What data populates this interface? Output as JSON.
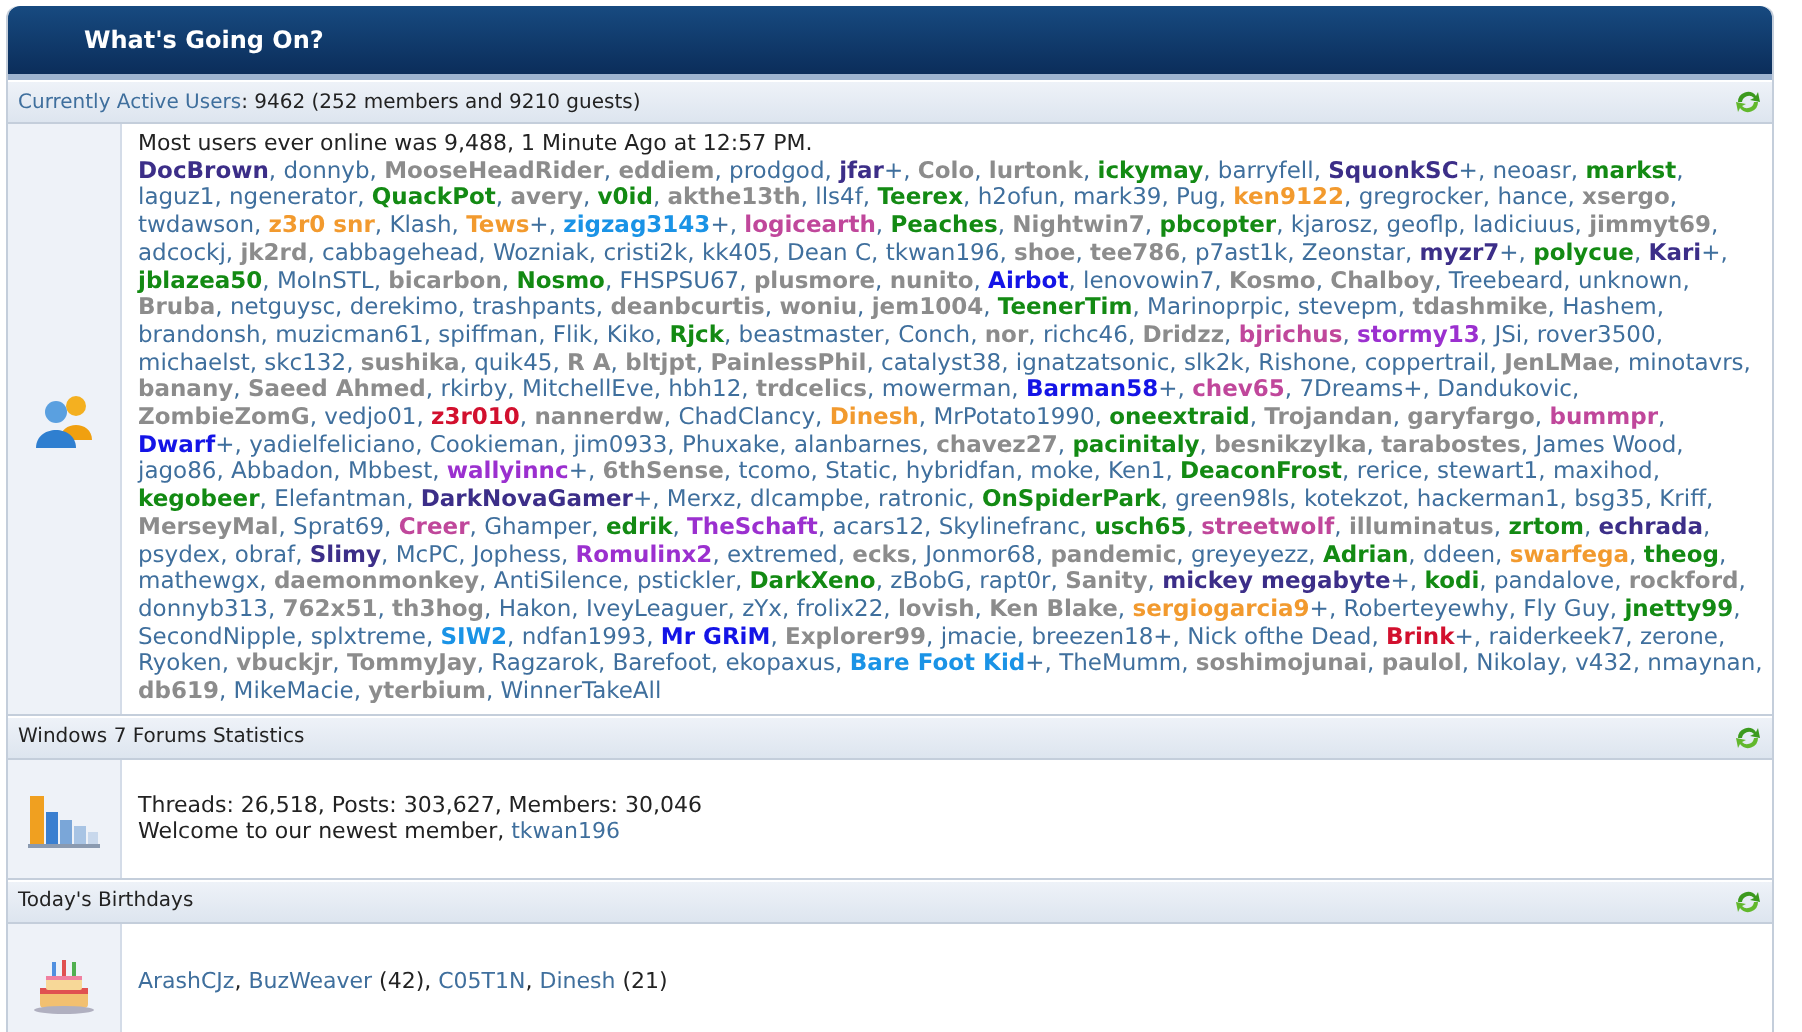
{
  "panel": {
    "title": "What's Going On?"
  },
  "active_users": {
    "label": "Currently Active Users",
    "summary": ": 9462 (252 members and 9210 guests)",
    "record": "Most users ever online was 9,488, 1 Minute Ago at 12:57 PM.",
    "separator": ", ",
    "users": [
      {
        "name": "DocBrown",
        "color": "#3c2e88",
        "bold": true
      },
      {
        "name": "donnyb",
        "color": "#3f6f9d",
        "bold": false
      },
      {
        "name": "MooseHeadRider",
        "color": "#8c8c8c",
        "bold": true
      },
      {
        "name": "eddiem",
        "color": "#8c8c8c",
        "bold": true
      },
      {
        "name": "prodgod",
        "color": "#3f6f9d",
        "bold": false
      },
      {
        "name": "jfar",
        "color": "#3c2e88",
        "bold": true,
        "suffix": "+"
      },
      {
        "name": "Colo",
        "color": "#8c8c8c",
        "bold": true
      },
      {
        "name": "lurtonk",
        "color": "#8c8c8c",
        "bold": true
      },
      {
        "name": "ickymay",
        "color": "#138a13",
        "bold": true
      },
      {
        "name": "barryfell",
        "color": "#3f6f9d",
        "bold": false
      },
      {
        "name": "SquonkSC",
        "color": "#3c2e88",
        "bold": true,
        "suffix": "+"
      },
      {
        "name": "neoasr",
        "color": "#3f6f9d",
        "bold": false
      },
      {
        "name": "markst",
        "color": "#138a13",
        "bold": true
      },
      {
        "name": "laguz1",
        "color": "#3f6f9d",
        "bold": false
      },
      {
        "name": "ngenerator",
        "color": "#3f6f9d",
        "bold": false
      },
      {
        "name": "QuackPot",
        "color": "#138a13",
        "bold": true
      },
      {
        "name": "avery",
        "color": "#8c8c8c",
        "bold": true
      },
      {
        "name": "v0id",
        "color": "#138a13",
        "bold": true
      },
      {
        "name": "akthe13th",
        "color": "#8c8c8c",
        "bold": true
      },
      {
        "name": "lls4f",
        "color": "#3f6f9d",
        "bold": false
      },
      {
        "name": "Teerex",
        "color": "#138a13",
        "bold": true
      },
      {
        "name": "h2ofun",
        "color": "#3f6f9d",
        "bold": false
      },
      {
        "name": "mark39",
        "color": "#3f6f9d",
        "bold": false
      },
      {
        "name": "Pug",
        "color": "#3f6f9d",
        "bold": false
      },
      {
        "name": "ken9122",
        "color": "#f29a2e",
        "bold": true
      },
      {
        "name": "gregrocker",
        "color": "#3f6f9d",
        "bold": false
      },
      {
        "name": "hance",
        "color": "#3f6f9d",
        "bold": false
      },
      {
        "name": "xsergo",
        "color": "#8c8c8c",
        "bold": true
      },
      {
        "name": "twdawson",
        "color": "#3f6f9d",
        "bold": false
      },
      {
        "name": "z3r0 snr",
        "color": "#f29a2e",
        "bold": true
      },
      {
        "name": "Klash",
        "color": "#3f6f9d",
        "bold": false
      },
      {
        "name": "Tews",
        "color": "#f29a2e",
        "bold": true,
        "suffix": "+"
      },
      {
        "name": "zigzag3143",
        "color": "#1a93e6",
        "bold": true,
        "suffix": "+"
      },
      {
        "name": "logicearth",
        "color": "#c0479b",
        "bold": true
      },
      {
        "name": "Peaches",
        "color": "#138a13",
        "bold": true
      },
      {
        "name": "Nightwin7",
        "color": "#8c8c8c",
        "bold": true
      },
      {
        "name": "pbcopter",
        "color": "#138a13",
        "bold": true
      },
      {
        "name": "kjarosz",
        "color": "#3f6f9d",
        "bold": false
      },
      {
        "name": "geoflp",
        "color": "#3f6f9d",
        "bold": false
      },
      {
        "name": "ladiciuus",
        "color": "#3f6f9d",
        "bold": false
      },
      {
        "name": "jimmyt69",
        "color": "#8c8c8c",
        "bold": true
      },
      {
        "name": "adcockj",
        "color": "#3f6f9d",
        "bold": false
      },
      {
        "name": "jk2rd",
        "color": "#8c8c8c",
        "bold": true
      },
      {
        "name": "cabbagehead",
        "color": "#3f6f9d",
        "bold": false
      },
      {
        "name": "Wozniak",
        "color": "#3f6f9d",
        "bold": false
      },
      {
        "name": "cristi2k",
        "color": "#3f6f9d",
        "bold": false
      },
      {
        "name": "kk405",
        "color": "#3f6f9d",
        "bold": false
      },
      {
        "name": "Dean C",
        "color": "#3f6f9d",
        "bold": false
      },
      {
        "name": "tkwan196",
        "color": "#3f6f9d",
        "bold": false
      },
      {
        "name": "shoe",
        "color": "#8c8c8c",
        "bold": true
      },
      {
        "name": "tee786",
        "color": "#8c8c8c",
        "bold": true
      },
      {
        "name": "p7ast1k",
        "color": "#3f6f9d",
        "bold": false
      },
      {
        "name": "Zeonstar",
        "color": "#3f6f9d",
        "bold": false
      },
      {
        "name": "myzr7",
        "color": "#3c2e88",
        "bold": true,
        "suffix": "+"
      },
      {
        "name": "polycue",
        "color": "#138a13",
        "bold": true
      },
      {
        "name": "Kari",
        "color": "#3c2e88",
        "bold": true,
        "suffix": "+"
      },
      {
        "name": "jblazea50",
        "color": "#138a13",
        "bold": true
      },
      {
        "name": "MoInSTL",
        "color": "#3f6f9d",
        "bold": false
      },
      {
        "name": "bicarbon",
        "color": "#8c8c8c",
        "bold": true
      },
      {
        "name": "Nosmo",
        "color": "#138a13",
        "bold": true
      },
      {
        "name": "FHSPSU67",
        "color": "#3f6f9d",
        "bold": false
      },
      {
        "name": "plusmore",
        "color": "#8c8c8c",
        "bold": true
      },
      {
        "name": "nunito",
        "color": "#8c8c8c",
        "bold": true
      },
      {
        "name": "Airbot",
        "color": "#1414e6",
        "bold": true
      },
      {
        "name": "lenovowin7",
        "color": "#3f6f9d",
        "bold": false
      },
      {
        "name": "Kosmo",
        "color": "#8c8c8c",
        "bold": true
      },
      {
        "name": "Chalboy",
        "color": "#8c8c8c",
        "bold": true
      },
      {
        "name": "Treebeard",
        "color": "#3f6f9d",
        "bold": false
      },
      {
        "name": "unknown",
        "color": "#3f6f9d",
        "bold": false
      },
      {
        "name": "Bruba",
        "color": "#8c8c8c",
        "bold": true
      },
      {
        "name": "netguysc",
        "color": "#3f6f9d",
        "bold": false
      },
      {
        "name": "derekimo",
        "color": "#3f6f9d",
        "bold": false
      },
      {
        "name": "trashpants",
        "color": "#3f6f9d",
        "bold": false
      },
      {
        "name": "deanbcurtis",
        "color": "#8c8c8c",
        "bold": true
      },
      {
        "name": "woniu",
        "color": "#8c8c8c",
        "bold": true
      },
      {
        "name": "jem1004",
        "color": "#8c8c8c",
        "bold": true
      },
      {
        "name": "TeenerTim",
        "color": "#138a13",
        "bold": true
      },
      {
        "name": "Marinoprpic",
        "color": "#3f6f9d",
        "bold": false
      },
      {
        "name": "stevepm",
        "color": "#3f6f9d",
        "bold": false
      },
      {
        "name": "tdashmike",
        "color": "#8c8c8c",
        "bold": true
      },
      {
        "name": "Hashem",
        "color": "#3f6f9d",
        "bold": false
      },
      {
        "name": "brandonsh",
        "color": "#3f6f9d",
        "bold": false
      },
      {
        "name": "muzicman61",
        "color": "#3f6f9d",
        "bold": false
      },
      {
        "name": "spiffman",
        "color": "#3f6f9d",
        "bold": false
      },
      {
        "name": "Flik",
        "color": "#3f6f9d",
        "bold": false
      },
      {
        "name": "Kiko",
        "color": "#3f6f9d",
        "bold": false
      },
      {
        "name": "Rjck",
        "color": "#138a13",
        "bold": true
      },
      {
        "name": "beastmaster",
        "color": "#3f6f9d",
        "bold": false
      },
      {
        "name": "Conch",
        "color": "#3f6f9d",
        "bold": false
      },
      {
        "name": "nor",
        "color": "#8c8c8c",
        "bold": true
      },
      {
        "name": "richc46",
        "color": "#3f6f9d",
        "bold": false
      },
      {
        "name": "Dridzz",
        "color": "#8c8c8c",
        "bold": true
      },
      {
        "name": "bjrichus",
        "color": "#c0479b",
        "bold": true
      },
      {
        "name": "stormy13",
        "color": "#9b30cf",
        "bold": true
      },
      {
        "name": "JSi",
        "color": "#3f6f9d",
        "bold": false
      },
      {
        "name": "rover3500",
        "color": "#3f6f9d",
        "bold": false
      },
      {
        "name": "michaelst",
        "color": "#3f6f9d",
        "bold": false
      },
      {
        "name": "skc132",
        "color": "#3f6f9d",
        "bold": false
      },
      {
        "name": "sushika",
        "color": "#8c8c8c",
        "bold": true
      },
      {
        "name": "quik45",
        "color": "#3f6f9d",
        "bold": false
      },
      {
        "name": "R A",
        "color": "#8c8c8c",
        "bold": true
      },
      {
        "name": "bltjpt",
        "color": "#8c8c8c",
        "bold": true
      },
      {
        "name": "PainlessPhil",
        "color": "#8c8c8c",
        "bold": true
      },
      {
        "name": "catalyst38",
        "color": "#3f6f9d",
        "bold": false
      },
      {
        "name": "ignatzatsonic",
        "color": "#3f6f9d",
        "bold": false
      },
      {
        "name": "slk2k",
        "color": "#3f6f9d",
        "bold": false
      },
      {
        "name": "Rishone",
        "color": "#3f6f9d",
        "bold": false
      },
      {
        "name": "coppertrail",
        "color": "#3f6f9d",
        "bold": false
      },
      {
        "name": "JenLMae",
        "color": "#8c8c8c",
        "bold": true
      },
      {
        "name": "minotavrs",
        "color": "#3f6f9d",
        "bold": false
      },
      {
        "name": "banany",
        "color": "#8c8c8c",
        "bold": true
      },
      {
        "name": "Saeed Ahmed",
        "color": "#8c8c8c",
        "bold": true
      },
      {
        "name": "rkirby",
        "color": "#3f6f9d",
        "bold": false
      },
      {
        "name": "MitchellEve",
        "color": "#3f6f9d",
        "bold": false
      },
      {
        "name": "hbh12",
        "color": "#3f6f9d",
        "bold": false
      },
      {
        "name": "trdcelics",
        "color": "#8c8c8c",
        "bold": true
      },
      {
        "name": "mowerman",
        "color": "#3f6f9d",
        "bold": false
      },
      {
        "name": "Barman58",
        "color": "#1414e6",
        "bold": true,
        "suffix": "+"
      },
      {
        "name": "chev65",
        "color": "#c0479b",
        "bold": true
      },
      {
        "name": "7Dreams",
        "color": "#3f6f9d",
        "bold": false,
        "suffix": "+"
      },
      {
        "name": "Dandukovic",
        "color": "#3f6f9d",
        "bold": false
      },
      {
        "name": "ZombieZomG",
        "color": "#8c8c8c",
        "bold": true
      },
      {
        "name": "vedjo01",
        "color": "#3f6f9d",
        "bold": false
      },
      {
        "name": "z3r010",
        "color": "#d2102e",
        "bold": true
      },
      {
        "name": "nannerdw",
        "color": "#8c8c8c",
        "bold": true
      },
      {
        "name": "ChadClancy",
        "color": "#3f6f9d",
        "bold": false
      },
      {
        "name": "Dinesh",
        "color": "#f29a2e",
        "bold": true
      },
      {
        "name": "MrPotato1990",
        "color": "#3f6f9d",
        "bold": false
      },
      {
        "name": "oneextraid",
        "color": "#138a13",
        "bold": true
      },
      {
        "name": "Trojandan",
        "color": "#8c8c8c",
        "bold": true
      },
      {
        "name": "garyfargo",
        "color": "#8c8c8c",
        "bold": true
      },
      {
        "name": "bummpr",
        "color": "#c0479b",
        "bold": true
      },
      {
        "name": "Dwarf",
        "color": "#1414e6",
        "bold": true,
        "suffix": "+"
      },
      {
        "name": "yadielfeliciano",
        "color": "#3f6f9d",
        "bold": false
      },
      {
        "name": "Cookieman",
        "color": "#3f6f9d",
        "bold": false
      },
      {
        "name": "jim0933",
        "color": "#3f6f9d",
        "bold": false
      },
      {
        "name": "Phuxake",
        "color": "#3f6f9d",
        "bold": false
      },
      {
        "name": "alanbarnes",
        "color": "#3f6f9d",
        "bold": false
      },
      {
        "name": "chavez27",
        "color": "#8c8c8c",
        "bold": true
      },
      {
        "name": "pacinitaly",
        "color": "#138a13",
        "bold": true
      },
      {
        "name": "besnikzylka",
        "color": "#8c8c8c",
        "bold": true
      },
      {
        "name": "tarabostes",
        "color": "#8c8c8c",
        "bold": true
      },
      {
        "name": "James Wood",
        "color": "#3f6f9d",
        "bold": false
      },
      {
        "name": "jago86",
        "color": "#3f6f9d",
        "bold": false
      },
      {
        "name": "Abbadon",
        "color": "#3f6f9d",
        "bold": false
      },
      {
        "name": "Mbbest",
        "color": "#3f6f9d",
        "bold": false
      },
      {
        "name": "wallyinnc",
        "color": "#9b30cf",
        "bold": true,
        "suffix": "+"
      },
      {
        "name": "6thSense",
        "color": "#8c8c8c",
        "bold": true
      },
      {
        "name": "tcomo",
        "color": "#3f6f9d",
        "bold": false
      },
      {
        "name": "Static",
        "color": "#3f6f9d",
        "bold": false
      },
      {
        "name": "hybridfan",
        "color": "#3f6f9d",
        "bold": false
      },
      {
        "name": "moke",
        "color": "#3f6f9d",
        "bold": false
      },
      {
        "name": "Ken1",
        "color": "#3f6f9d",
        "bold": false
      },
      {
        "name": "DeaconFrost",
        "color": "#138a13",
        "bold": true
      },
      {
        "name": "rerice",
        "color": "#3f6f9d",
        "bold": false
      },
      {
        "name": "stewart1",
        "color": "#3f6f9d",
        "bold": false
      },
      {
        "name": "maxihod",
        "color": "#3f6f9d",
        "bold": false
      },
      {
        "name": "kegobeer",
        "color": "#138a13",
        "bold": true
      },
      {
        "name": "Elefantman",
        "color": "#3f6f9d",
        "bold": false
      },
      {
        "name": "DarkNovaGamer",
        "color": "#3c2e88",
        "bold": true,
        "suffix": "+"
      },
      {
        "name": "Merxz",
        "color": "#3f6f9d",
        "bold": false
      },
      {
        "name": "dlcampbe",
        "color": "#3f6f9d",
        "bold": false
      },
      {
        "name": "ratronic",
        "color": "#3f6f9d",
        "bold": false
      },
      {
        "name": "OnSpiderPark",
        "color": "#138a13",
        "bold": true
      },
      {
        "name": "green98ls",
        "color": "#3f6f9d",
        "bold": false
      },
      {
        "name": "kotekzot",
        "color": "#3f6f9d",
        "bold": false
      },
      {
        "name": "hackerman1",
        "color": "#3f6f9d",
        "bold": false
      },
      {
        "name": "bsg35",
        "color": "#3f6f9d",
        "bold": false
      },
      {
        "name": "Kriff",
        "color": "#3f6f9d",
        "bold": false
      },
      {
        "name": "MerseyMal",
        "color": "#8c8c8c",
        "bold": true
      },
      {
        "name": "Sprat69",
        "color": "#3f6f9d",
        "bold": false
      },
      {
        "name": "Creer",
        "color": "#c0479b",
        "bold": true
      },
      {
        "name": "Ghamper",
        "color": "#3f6f9d",
        "bold": false
      },
      {
        "name": "edrik",
        "color": "#138a13",
        "bold": true
      },
      {
        "name": "TheSchaft",
        "color": "#9b30cf",
        "bold": true
      },
      {
        "name": "acars12",
        "color": "#3f6f9d",
        "bold": false
      },
      {
        "name": "Skylinefranc",
        "color": "#3f6f9d",
        "bold": false
      },
      {
        "name": "usch65",
        "color": "#138a13",
        "bold": true
      },
      {
        "name": "streetwolf",
        "color": "#c0479b",
        "bold": true
      },
      {
        "name": "illuminatus",
        "color": "#8c8c8c",
        "bold": true
      },
      {
        "name": "zrtom",
        "color": "#138a13",
        "bold": true
      },
      {
        "name": "echrada",
        "color": "#3c2e88",
        "bold": true
      },
      {
        "name": "psydex",
        "color": "#3f6f9d",
        "bold": false
      },
      {
        "name": "obraf",
        "color": "#3f6f9d",
        "bold": false
      },
      {
        "name": "Slimy",
        "color": "#3c2e88",
        "bold": true
      },
      {
        "name": "McPC",
        "color": "#3f6f9d",
        "bold": false
      },
      {
        "name": "Jophess",
        "color": "#3f6f9d",
        "bold": false
      },
      {
        "name": "Romulinx2",
        "color": "#9b30cf",
        "bold": true
      },
      {
        "name": "extremed",
        "color": "#3f6f9d",
        "bold": false
      },
      {
        "name": "ecks",
        "color": "#8c8c8c",
        "bold": true
      },
      {
        "name": "Jonmor68",
        "color": "#3f6f9d",
        "bold": false
      },
      {
        "name": "pandemic",
        "color": "#8c8c8c",
        "bold": true
      },
      {
        "name": "greyeyezz",
        "color": "#3f6f9d",
        "bold": false
      },
      {
        "name": "Adrian",
        "color": "#138a13",
        "bold": true
      },
      {
        "name": "ddeen",
        "color": "#3f6f9d",
        "bold": false
      },
      {
        "name": "swarfega",
        "color": "#f29a2e",
        "bold": true
      },
      {
        "name": "theog",
        "color": "#138a13",
        "bold": true
      },
      {
        "name": "mathewgx",
        "color": "#3f6f9d",
        "bold": false
      },
      {
        "name": "daemonmonkey",
        "color": "#8c8c8c",
        "bold": true
      },
      {
        "name": "AntiSilence",
        "color": "#3f6f9d",
        "bold": false
      },
      {
        "name": "pstickler",
        "color": "#3f6f9d",
        "bold": false
      },
      {
        "name": "DarkXeno",
        "color": "#138a13",
        "bold": true
      },
      {
        "name": "zBobG",
        "color": "#3f6f9d",
        "bold": false
      },
      {
        "name": "rapt0r",
        "color": "#3f6f9d",
        "bold": false
      },
      {
        "name": "Sanity",
        "color": "#8c8c8c",
        "bold": true
      },
      {
        "name": "mickey megabyte",
        "color": "#3c2e88",
        "bold": true,
        "suffix": "+"
      },
      {
        "name": "kodi",
        "color": "#138a13",
        "bold": true
      },
      {
        "name": "pandalove",
        "color": "#3f6f9d",
        "bold": false
      },
      {
        "name": "rockford",
        "color": "#8c8c8c",
        "bold": true
      },
      {
        "name": "donnyb313",
        "color": "#3f6f9d",
        "bold": false
      },
      {
        "name": "762x51",
        "color": "#8c8c8c",
        "bold": true
      },
      {
        "name": "th3hog",
        "color": "#8c8c8c",
        "bold": true
      },
      {
        "name": "Hakon",
        "color": "#3f6f9d",
        "bold": false
      },
      {
        "name": "IveyLeaguer",
        "color": "#3f6f9d",
        "bold": false
      },
      {
        "name": "zYx",
        "color": "#3f6f9d",
        "bold": false
      },
      {
        "name": "frolix22",
        "color": "#3f6f9d",
        "bold": false
      },
      {
        "name": "lovish",
        "color": "#8c8c8c",
        "bold": true
      },
      {
        "name": "Ken Blake",
        "color": "#8c8c8c",
        "bold": true
      },
      {
        "name": "sergiogarcia9",
        "color": "#f29a2e",
        "bold": true,
        "suffix": "+"
      },
      {
        "name": "Roberteyewhy",
        "color": "#3f6f9d",
        "bold": false
      },
      {
        "name": "Fly Guy",
        "color": "#3f6f9d",
        "bold": false
      },
      {
        "name": "jnetty99",
        "color": "#138a13",
        "bold": true
      },
      {
        "name": "SecondNipple",
        "color": "#3f6f9d",
        "bold": false
      },
      {
        "name": "splxtreme",
        "color": "#3f6f9d",
        "bold": false
      },
      {
        "name": "SIW2",
        "color": "#1a93e6",
        "bold": true
      },
      {
        "name": "ndfan1993",
        "color": "#3f6f9d",
        "bold": false
      },
      {
        "name": "Mr GRiM",
        "color": "#1414e6",
        "bold": true
      },
      {
        "name": "Explorer99",
        "color": "#8c8c8c",
        "bold": true
      },
      {
        "name": "jmacie",
        "color": "#3f6f9d",
        "bold": false
      },
      {
        "name": "breezen18",
        "color": "#3f6f9d",
        "bold": false,
        "suffix": "+"
      },
      {
        "name": "Nick ofthe Dead",
        "color": "#3f6f9d",
        "bold": false
      },
      {
        "name": "Brink",
        "color": "#d2102e",
        "bold": true,
        "suffix": "+"
      },
      {
        "name": "raiderkeek7",
        "color": "#3f6f9d",
        "bold": false
      },
      {
        "name": "zerone",
        "color": "#3f6f9d",
        "bold": false
      },
      {
        "name": "Ryoken",
        "color": "#3f6f9d",
        "bold": false
      },
      {
        "name": "vbuckjr",
        "color": "#8c8c8c",
        "bold": true
      },
      {
        "name": "TommyJay",
        "color": "#8c8c8c",
        "bold": true
      },
      {
        "name": "Ragzarok",
        "color": "#3f6f9d",
        "bold": false
      },
      {
        "name": "Barefoot",
        "color": "#3f6f9d",
        "bold": false
      },
      {
        "name": "ekopaxus",
        "color": "#3f6f9d",
        "bold": false
      },
      {
        "name": "Bare Foot Kid",
        "color": "#1a93e6",
        "bold": true,
        "suffix": "+"
      },
      {
        "name": "TheMumm",
        "color": "#3f6f9d",
        "bold": false
      },
      {
        "name": "soshimojunai",
        "color": "#8c8c8c",
        "bold": true
      },
      {
        "name": "paulol",
        "color": "#8c8c8c",
        "bold": true
      },
      {
        "name": "Nikolay",
        "color": "#3f6f9d",
        "bold": false
      },
      {
        "name": "v432",
        "color": "#3f6f9d",
        "bold": false
      },
      {
        "name": "nmaynan",
        "color": "#3f6f9d",
        "bold": false
      },
      {
        "name": "db619",
        "color": "#8c8c8c",
        "bold": true
      },
      {
        "name": "MikeMacie",
        "color": "#3f6f9d",
        "bold": false
      },
      {
        "name": "yterbium",
        "color": "#8c8c8c",
        "bold": true
      },
      {
        "name": "WinnerTakeAll",
        "color": "#3f6f9d",
        "bold": false
      }
    ]
  },
  "statistics": {
    "label": "Windows 7 Forums Statistics",
    "totals": "Threads: 26,518, Posts: 303,627, Members: 30,046",
    "welcome": "Welcome to our newest member, ",
    "newest_member": "tkwan196"
  },
  "birthdays": {
    "label": "Today's Birthdays",
    "separator": ", ",
    "people": [
      {
        "name": "ArashCJz"
      },
      {
        "name": "BuzWeaver",
        "age": "(42)"
      },
      {
        "name": "C05T1N"
      },
      {
        "name": "Dinesh",
        "age": "(21)"
      }
    ]
  }
}
